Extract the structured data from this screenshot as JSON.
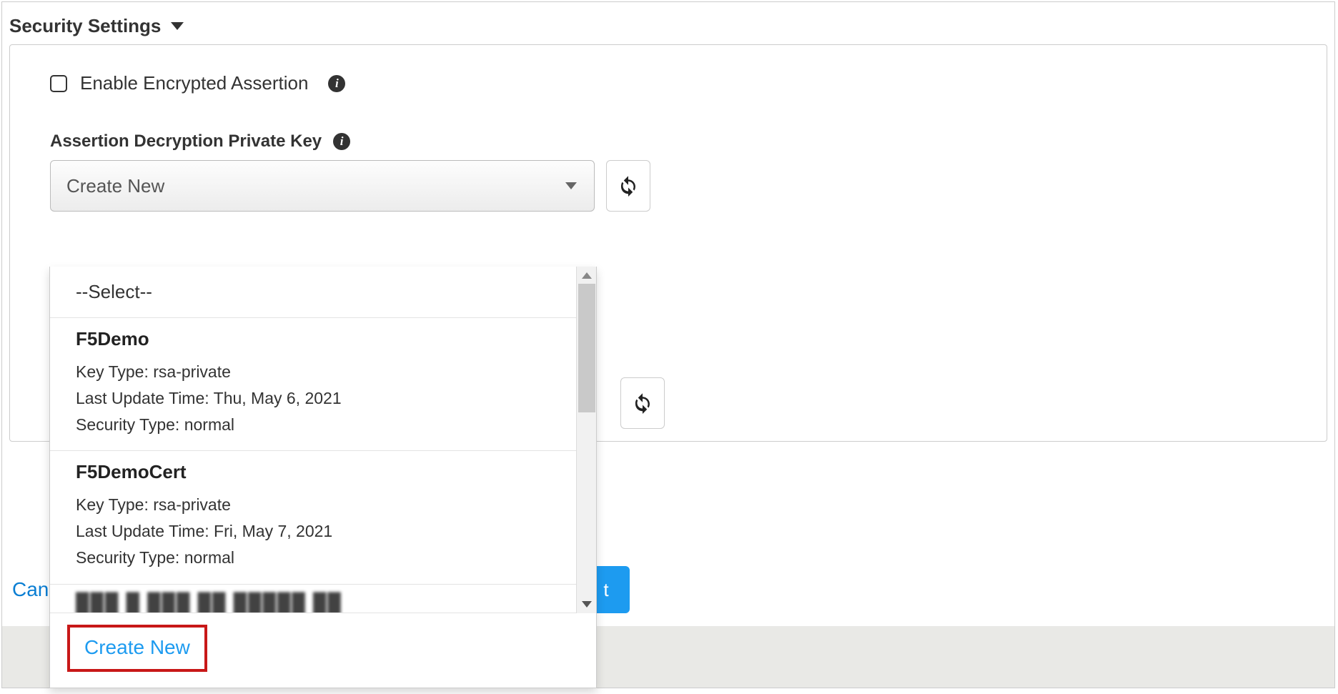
{
  "section": {
    "title": "Security Settings"
  },
  "checkbox": {
    "label": "Enable Encrypted Assertion"
  },
  "field": {
    "label": "Assertion Decryption Private Key"
  },
  "select": {
    "value": "Create New"
  },
  "dropdown": {
    "placeholder": "--Select--",
    "items": [
      {
        "name": "F5Demo",
        "key_type_label": "Key Type:",
        "key_type": "rsa-private",
        "last_update_label": "Last Update Time:",
        "last_update": "Thu, May 6, 2021",
        "security_type_label": "Security Type:",
        "security_type": "normal"
      },
      {
        "name": "F5DemoCert",
        "key_type_label": "Key Type:",
        "key_type": "rsa-private",
        "last_update_label": "Last Update Time:",
        "last_update": "Fri, May 7, 2021",
        "security_type_label": "Security Type:",
        "security_type": "normal"
      }
    ],
    "create_new": "Create New"
  },
  "footer": {
    "cancel": "Can",
    "next_fragment": "t"
  }
}
